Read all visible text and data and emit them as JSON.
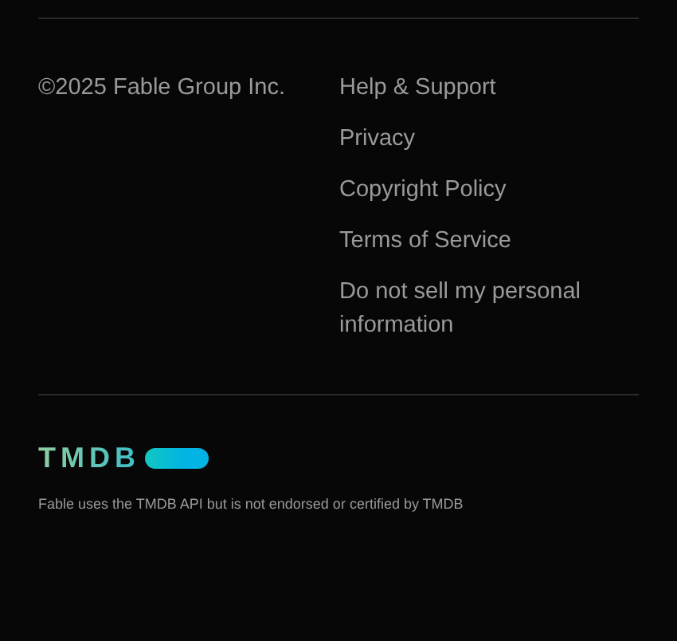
{
  "copyright": "©2025 Fable Group Inc.",
  "links": [
    "Help & Support",
    "Privacy",
    "Copyright Policy",
    "Terms of Service",
    "Do not sell my personal information"
  ],
  "logo": {
    "text": "TMDB"
  },
  "disclaimer": "Fable uses the TMDB API but is not endorsed or certified by TMDB"
}
